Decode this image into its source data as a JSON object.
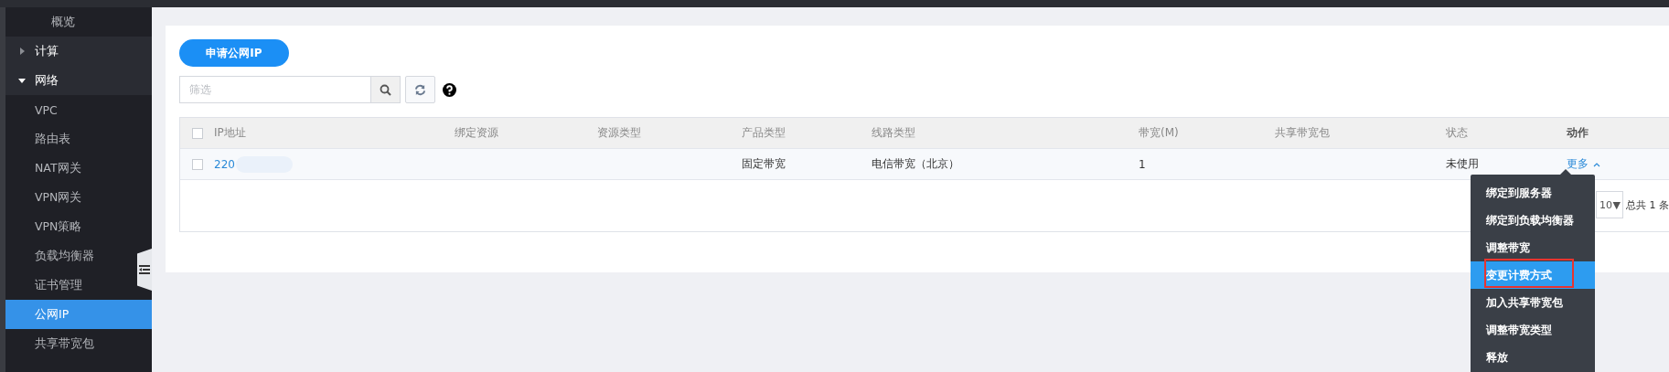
{
  "sidebar": {
    "items": [
      {
        "label": "概览",
        "kind": "link",
        "selected": false
      },
      {
        "label": "计算",
        "kind": "group",
        "expanded": false,
        "selected": false
      },
      {
        "label": "网络",
        "kind": "group",
        "expanded": true,
        "selected": false,
        "children": [
          {
            "label": "VPC",
            "selected": false
          },
          {
            "label": "路由表",
            "selected": false
          },
          {
            "label": "NAT网关",
            "selected": false
          },
          {
            "label": "VPN网关",
            "selected": false
          },
          {
            "label": "VPN策略",
            "selected": false
          },
          {
            "label": "负载均衡器",
            "selected": false
          },
          {
            "label": "证书管理",
            "selected": false
          },
          {
            "label": "公网IP",
            "selected": true
          },
          {
            "label": "共享带宽包",
            "selected": false
          }
        ]
      }
    ]
  },
  "toolbar": {
    "apply_button": "申请公网IP",
    "search": {
      "placeholder": "筛选"
    }
  },
  "table": {
    "header_checked": false,
    "columns": [
      "IP地址",
      "绑定资源",
      "资源类型",
      "产品类型",
      "线路类型",
      "带宽(M)",
      "共享带宽包",
      "状态",
      "动作"
    ],
    "rows": [
      {
        "checked": false,
        "cells": [
          "220",
          "",
          "",
          "固定带宽",
          "电信带宽（北京）",
          "1",
          "",
          "未使用"
        ],
        "action": {
          "label": "更多",
          "expanded": true
        }
      }
    ],
    "pagination": {
      "page_size": "10",
      "arrow": "▼",
      "total": "总共 1 条"
    }
  },
  "action_menu": {
    "items": [
      {
        "label": "绑定到服务器",
        "selected": false
      },
      {
        "label": "绑定到负载均衡器",
        "selected": false
      },
      {
        "label": "调整带宽",
        "selected": false
      },
      {
        "label": "变更计费方式",
        "selected": true,
        "annotated": true
      },
      {
        "label": "加入共享带宽包",
        "selected": false
      },
      {
        "label": "调整带宽类型",
        "selected": false
      },
      {
        "label": "释放",
        "selected": false
      }
    ]
  }
}
